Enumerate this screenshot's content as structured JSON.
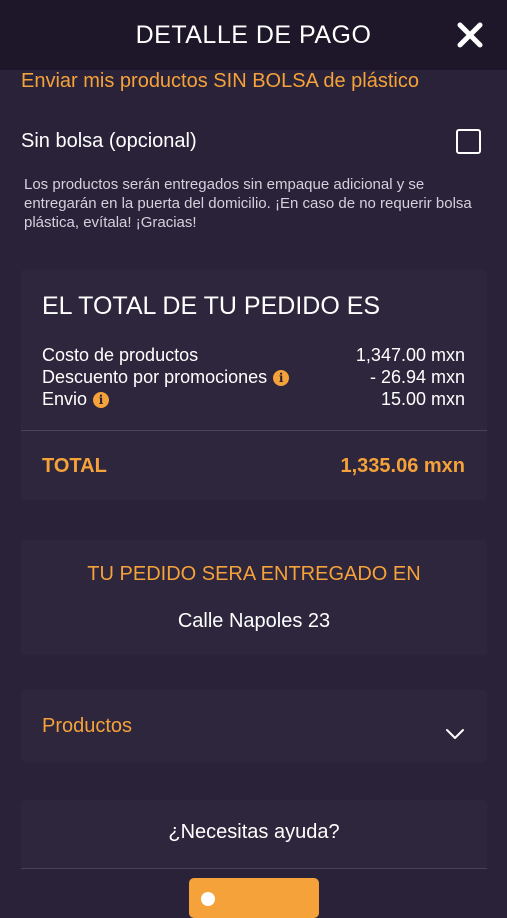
{
  "header": {
    "title": "DETALLE DE PAGO",
    "close_icon": "close-icon"
  },
  "bag": {
    "title": "Enviar mis productos SIN BOLSA de plástico",
    "option_label": "Sin bolsa (opcional)",
    "checked": false,
    "note": "Los productos serán entregados sin empaque adicional y se entregarán en la puerta del domicilio. ¡En caso de no requerir bolsa plástica, evítala! ¡Gracias!"
  },
  "order_total": {
    "heading": "EL TOTAL DE TU PEDIDO ES",
    "rows": [
      {
        "label": "Costo de productos",
        "value": "1,347.00 mxn",
        "info": false
      },
      {
        "label": "Descuento por promociones",
        "value": "- 26.94 mxn",
        "info": true
      },
      {
        "label": "Envio",
        "value": "15.00 mxn",
        "info": true
      }
    ],
    "total_label": "TOTAL",
    "total_value": "1,335.06 mxn"
  },
  "delivery": {
    "heading": "TU PEDIDO SERA ENTREGADO EN",
    "address": "Calle Napoles 23"
  },
  "products": {
    "label": "Productos",
    "expanded": false
  },
  "help": {
    "question": "¿Necesitas ayuda?"
  },
  "colors": {
    "accent": "#f5a23a",
    "background": "#2a2238",
    "header": "#1d1729"
  }
}
